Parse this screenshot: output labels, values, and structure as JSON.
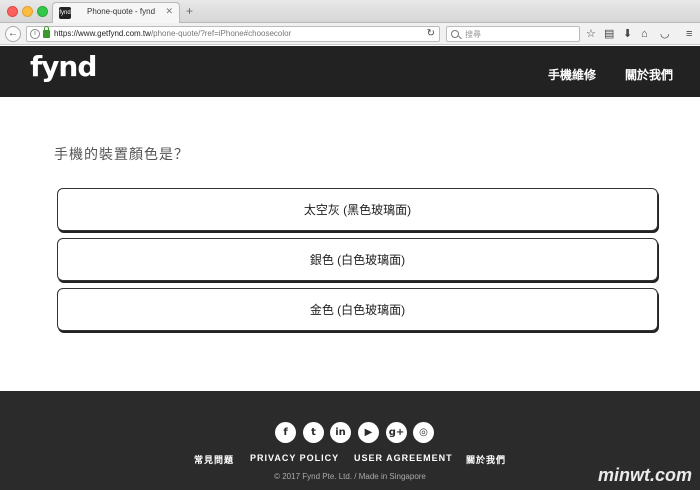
{
  "browser": {
    "tab_title": "Phone-quote - fynd",
    "favicon_text": "fynd",
    "url_host": "https://www.getfynd.com.tw",
    "url_path": "/phone-quote/?ref=iPhone#choosecolor",
    "search_placeholder": "搜尋"
  },
  "header": {
    "logo": "fynd",
    "nav": [
      "手機維修",
      "關於我們"
    ]
  },
  "main": {
    "question": "手機的裝置顏色是？",
    "options": [
      "太空灰 (黑色玻璃面)",
      "銀色 (白色玻璃面)",
      "金色 (白色玻璃面)"
    ]
  },
  "footer": {
    "social_icons": [
      "facebook-icon",
      "twitter-icon",
      "linkedin-icon",
      "youtube-icon",
      "google-plus-icon",
      "instagram-icon"
    ],
    "links": [
      "常見問題",
      "PRIVACY POLICY",
      "USER AGREEMENT",
      "關於我們"
    ],
    "copyright": "© 2017 Fynd Pte. Ltd. / Made in Singapore"
  },
  "watermark": "minwt.com"
}
